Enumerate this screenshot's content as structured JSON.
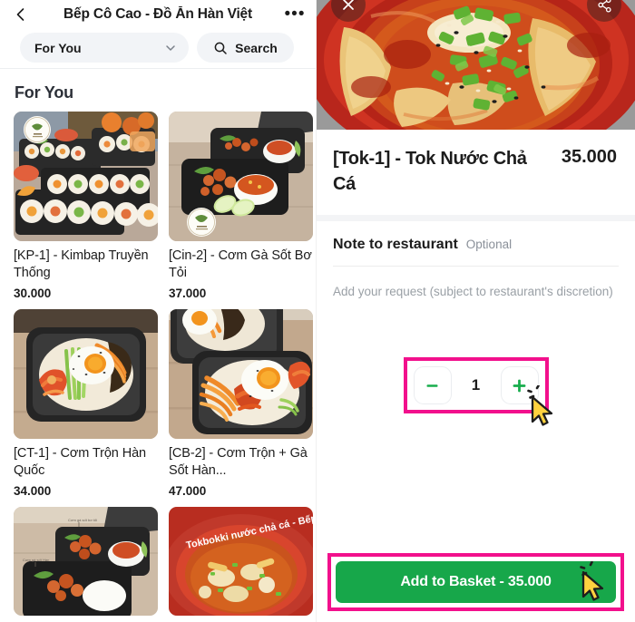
{
  "left": {
    "header": {
      "back_icon": "chevron-left-icon",
      "shop_title": "Bếp Cô Cao - Đồ Ăn Hàn Việt",
      "more_icon": "more-options-icon",
      "category_filter": "For You",
      "chevron_icon": "chevron-down-icon",
      "search_icon": "search-icon",
      "search_label": "Search"
    },
    "section_title": "For You",
    "items": [
      {
        "name": "[KP-1] - Kimbap Truyền Thống",
        "price": "30.000",
        "image": "kimbap-platter"
      },
      {
        "name": "[Cin-2] - Cơm Gà Sốt Bơ Tỏi",
        "price": "37.000",
        "image": "garlic-butter-chicken-rice"
      },
      {
        "name": "[CT-1] - Cơm Trộn Hàn Quốc",
        "price": "34.000",
        "image": "korean-bibimbap"
      },
      {
        "name": "[CB-2] - Cơm Trộn + Gà Sốt Hàn...",
        "price": "47.000",
        "image": "bibimbap-with-chicken"
      },
      {
        "name": "",
        "price": "",
        "image": "chicken-rice-boxes"
      },
      {
        "name": "",
        "price": "",
        "image": "tokbokki-fish-cake-soup"
      }
    ]
  },
  "right": {
    "hero": {
      "image": "tok-fish-cake-soup-bowl",
      "close_icon": "close-icon",
      "share_icon": "share-icon"
    },
    "item_name": "[Tok-1] - Tok Nước Chả Cá",
    "item_price": "35.000",
    "note": {
      "title": "Note to restaurant",
      "optional_label": "Optional",
      "placeholder": "Add your request (subject to restaurant's discretion)"
    },
    "stepper": {
      "decrement_icon": "minus-icon",
      "increment_icon": "plus-icon",
      "quantity": "1"
    },
    "add_to_basket_label": "Add to Basket - 35.000"
  },
  "colors": {
    "brand_green": "#17a74a",
    "highlight_pink": "#f2108c",
    "cursor_yellow": "#ffd23f",
    "pill_bg": "#f2f4f7"
  }
}
